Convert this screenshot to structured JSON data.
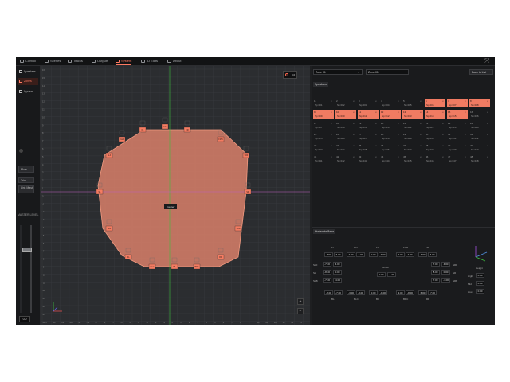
{
  "tabs": [
    {
      "label": "Control",
      "active": false
    },
    {
      "label": "Scenes",
      "active": false
    },
    {
      "label": "Tracks",
      "active": false
    },
    {
      "label": "Outputs",
      "active": false
    },
    {
      "label": "System",
      "active": true
    },
    {
      "label": "ID Edits",
      "active": false
    },
    {
      "label": "About",
      "active": false
    }
  ],
  "sidebar": {
    "items": [
      {
        "label": "Speakers",
        "active": false
      },
      {
        "label": "Zones",
        "active": true
      },
      {
        "label": "System",
        "active": false
      }
    ],
    "buttons": [
      {
        "label": "Mute"
      },
      {
        "label": "Trim"
      },
      {
        "label": "Link Mast"
      }
    ],
    "master_label": "MASTER LEVEL",
    "master_value": "0.0"
  },
  "canvas": {
    "record_value": "0.0",
    "center_label": "Center",
    "x_ticks": [
      "-15",
      "-14",
      "-13",
      "-12",
      "-11",
      "-10",
      "-9",
      "-8",
      "-7",
      "-6",
      "-5",
      "-4",
      "-3",
      "-2",
      "-1",
      "0",
      "1",
      "2",
      "3",
      "4",
      "5",
      "6",
      "7",
      "8",
      "9",
      "10",
      "11",
      "12",
      "13",
      "14",
      "15"
    ],
    "y_ticks": [
      "16",
      "15",
      "14",
      "13",
      "12",
      "11",
      "10",
      "9",
      "8",
      "7",
      "6",
      "5",
      "4",
      "3",
      "2",
      "1",
      "0",
      "-1",
      "-2",
      "-3",
      "-4",
      "-5",
      "-6",
      "-7",
      "-8",
      "-9",
      "-10",
      "-11",
      "-12",
      "-13",
      "-14",
      "-15",
      "-16"
    ],
    "speakers": [
      "FL",
      "FC",
      "FR",
      "FLW",
      "FRW",
      "SLF",
      "SRF",
      "SL",
      "SR",
      "SLB",
      "SRB",
      "RL",
      "RR",
      "BLC",
      "BL",
      "BRC"
    ]
  },
  "right": {
    "zone_select": "Zone 01",
    "zone_name": "Zone 01",
    "back_label": "Back to List",
    "speakers_title": "Speakers",
    "speaker_rows": [
      [
        {
          "n": "1",
          "d": "Sp 001",
          "on": false
        },
        {
          "n": "2",
          "d": "Sp 002",
          "on": false
        },
        {
          "n": "3",
          "d": "Sp 003",
          "on": false
        },
        {
          "n": "4",
          "d": "Sp 004",
          "on": false
        },
        {
          "n": "5",
          "d": "Sp 005",
          "on": false
        },
        {
          "n": "6",
          "d": "Sp 006",
          "on": true
        },
        {
          "n": "7",
          "d": "Sp 007",
          "on": true
        },
        {
          "n": "8",
          "d": "Sp 008",
          "on": true
        }
      ],
      [
        {
          "n": "9",
          "d": "Sp 009",
          "on": true
        },
        {
          "n": "10",
          "d": "Sp 010",
          "on": true
        },
        {
          "n": "11",
          "d": "Sp 011",
          "on": true
        },
        {
          "n": "12",
          "d": "Sp 012",
          "on": true
        },
        {
          "n": "13",
          "d": "Sp 013",
          "on": true
        },
        {
          "n": "14",
          "d": "Sp 014",
          "on": true
        },
        {
          "n": "15",
          "d": "Sp 015",
          "on": true
        },
        {
          "n": "16",
          "d": "Sp 016",
          "on": false
        }
      ],
      [
        {
          "n": "17",
          "d": "Sp 017",
          "on": false
        },
        {
          "n": "18",
          "d": "Sp 018",
          "on": false
        },
        {
          "n": "19",
          "d": "Sp 019",
          "on": false
        },
        {
          "n": "20",
          "d": "Sp 020",
          "on": false
        },
        {
          "n": "21",
          "d": "Sp 021",
          "on": false
        },
        {
          "n": "22",
          "d": "Sp 022",
          "on": false
        },
        {
          "n": "23",
          "d": "Sp 023",
          "on": false
        },
        {
          "n": "24",
          "d": "Sp 024",
          "on": false
        }
      ],
      [
        {
          "n": "25",
          "d": "Sp 025",
          "on": false
        },
        {
          "n": "26",
          "d": "Sp 026",
          "on": false
        },
        {
          "n": "27",
          "d": "Sp 027",
          "on": false
        },
        {
          "n": "28",
          "d": "Sp 028",
          "on": false
        },
        {
          "n": "29",
          "d": "Sp 029",
          "on": false
        },
        {
          "n": "30",
          "d": "Sp 030",
          "on": false
        },
        {
          "n": "31",
          "d": "Sp 031",
          "on": false
        },
        {
          "n": "32",
          "d": "Sp 032",
          "on": false
        }
      ],
      [
        {
          "n": "33",
          "d": "Sp 033",
          "on": false
        },
        {
          "n": "34",
          "d": "Sp 034",
          "on": false
        },
        {
          "n": "35",
          "d": "Sp 035",
          "on": false
        },
        {
          "n": "36",
          "d": "Sp 036",
          "on": false
        },
        {
          "n": "37",
          "d": "Sp 037",
          "on": false
        },
        {
          "n": "38",
          "d": "Sp 038",
          "on": false
        },
        {
          "n": "39",
          "d": "Sp 039",
          "on": false
        },
        {
          "n": "40",
          "d": "Sp 040",
          "on": false
        }
      ],
      [
        {
          "n": "41",
          "d": "Sp 041",
          "on": false
        },
        {
          "n": "42",
          "d": "Sp 042",
          "on": false
        },
        {
          "n": "43",
          "d": "Sp 043",
          "on": false
        },
        {
          "n": "44",
          "d": "Sp 044",
          "on": false
        },
        {
          "n": "45",
          "d": "Sp 045",
          "on": false
        },
        {
          "n": "46",
          "d": "Sp 046",
          "on": false
        },
        {
          "n": "47",
          "d": "Sp 047",
          "on": false
        },
        {
          "n": "48",
          "d": "Sp 048",
          "on": false
        }
      ]
    ],
    "hv_title": "Horizontal Area",
    "hv_columns": [
      "FL",
      "FCL",
      "FC",
      "FCR",
      "FR"
    ],
    "hv_top": [
      [
        "4.00",
        "6.00"
      ],
      [
        "3.00",
        "7.00"
      ],
      [
        "0.00",
        "7.00"
      ],
      [
        "3.00",
        "7.00"
      ],
      [
        "4.00",
        "6.00"
      ]
    ],
    "hv_rows": [
      {
        "label": "SLF",
        "values": [
          "-7.00",
          "4.00"
        ]
      },
      {
        "label": "SL",
        "values": [
          "-8.00",
          "0.00"
        ]
      },
      {
        "label": "SLB",
        "values": [
          "-7.00",
          "-4.00"
        ]
      }
    ],
    "hv_center_label": "Center",
    "hv_center": [
      "0.00",
      "1.40"
    ],
    "hv_right": [
      [
        "7.00",
        "4.00"
      ],
      [
        "8.00",
        "0.00"
      ],
      [
        "7.00",
        "-4.00"
      ]
    ],
    "hv_right_labels": [
      "SRF",
      "SR",
      "SRB"
    ],
    "hv_bottom": [
      [
        "-6.00",
        "-7.00"
      ],
      [
        "-3.00",
        "-8.00"
      ],
      [
        "0.00",
        "-8.00"
      ],
      [
        "3.00",
        "-8.00"
      ],
      [
        "6.00",
        "-7.00"
      ]
    ],
    "hv_bottom_labels": [
      "BL",
      "BLC",
      "BC",
      "BRC",
      "BR"
    ],
    "height_label": "Height",
    "height_rows": [
      {
        "label": "High",
        "value": "0.00"
      },
      {
        "label": "Mid",
        "value": "0.00"
      },
      {
        "label": "Low",
        "value": "0.00"
      }
    ]
  },
  "colors": {
    "accent": "#f07b62",
    "zone_fill": "#e8836a",
    "bg": "#1e1f21"
  }
}
